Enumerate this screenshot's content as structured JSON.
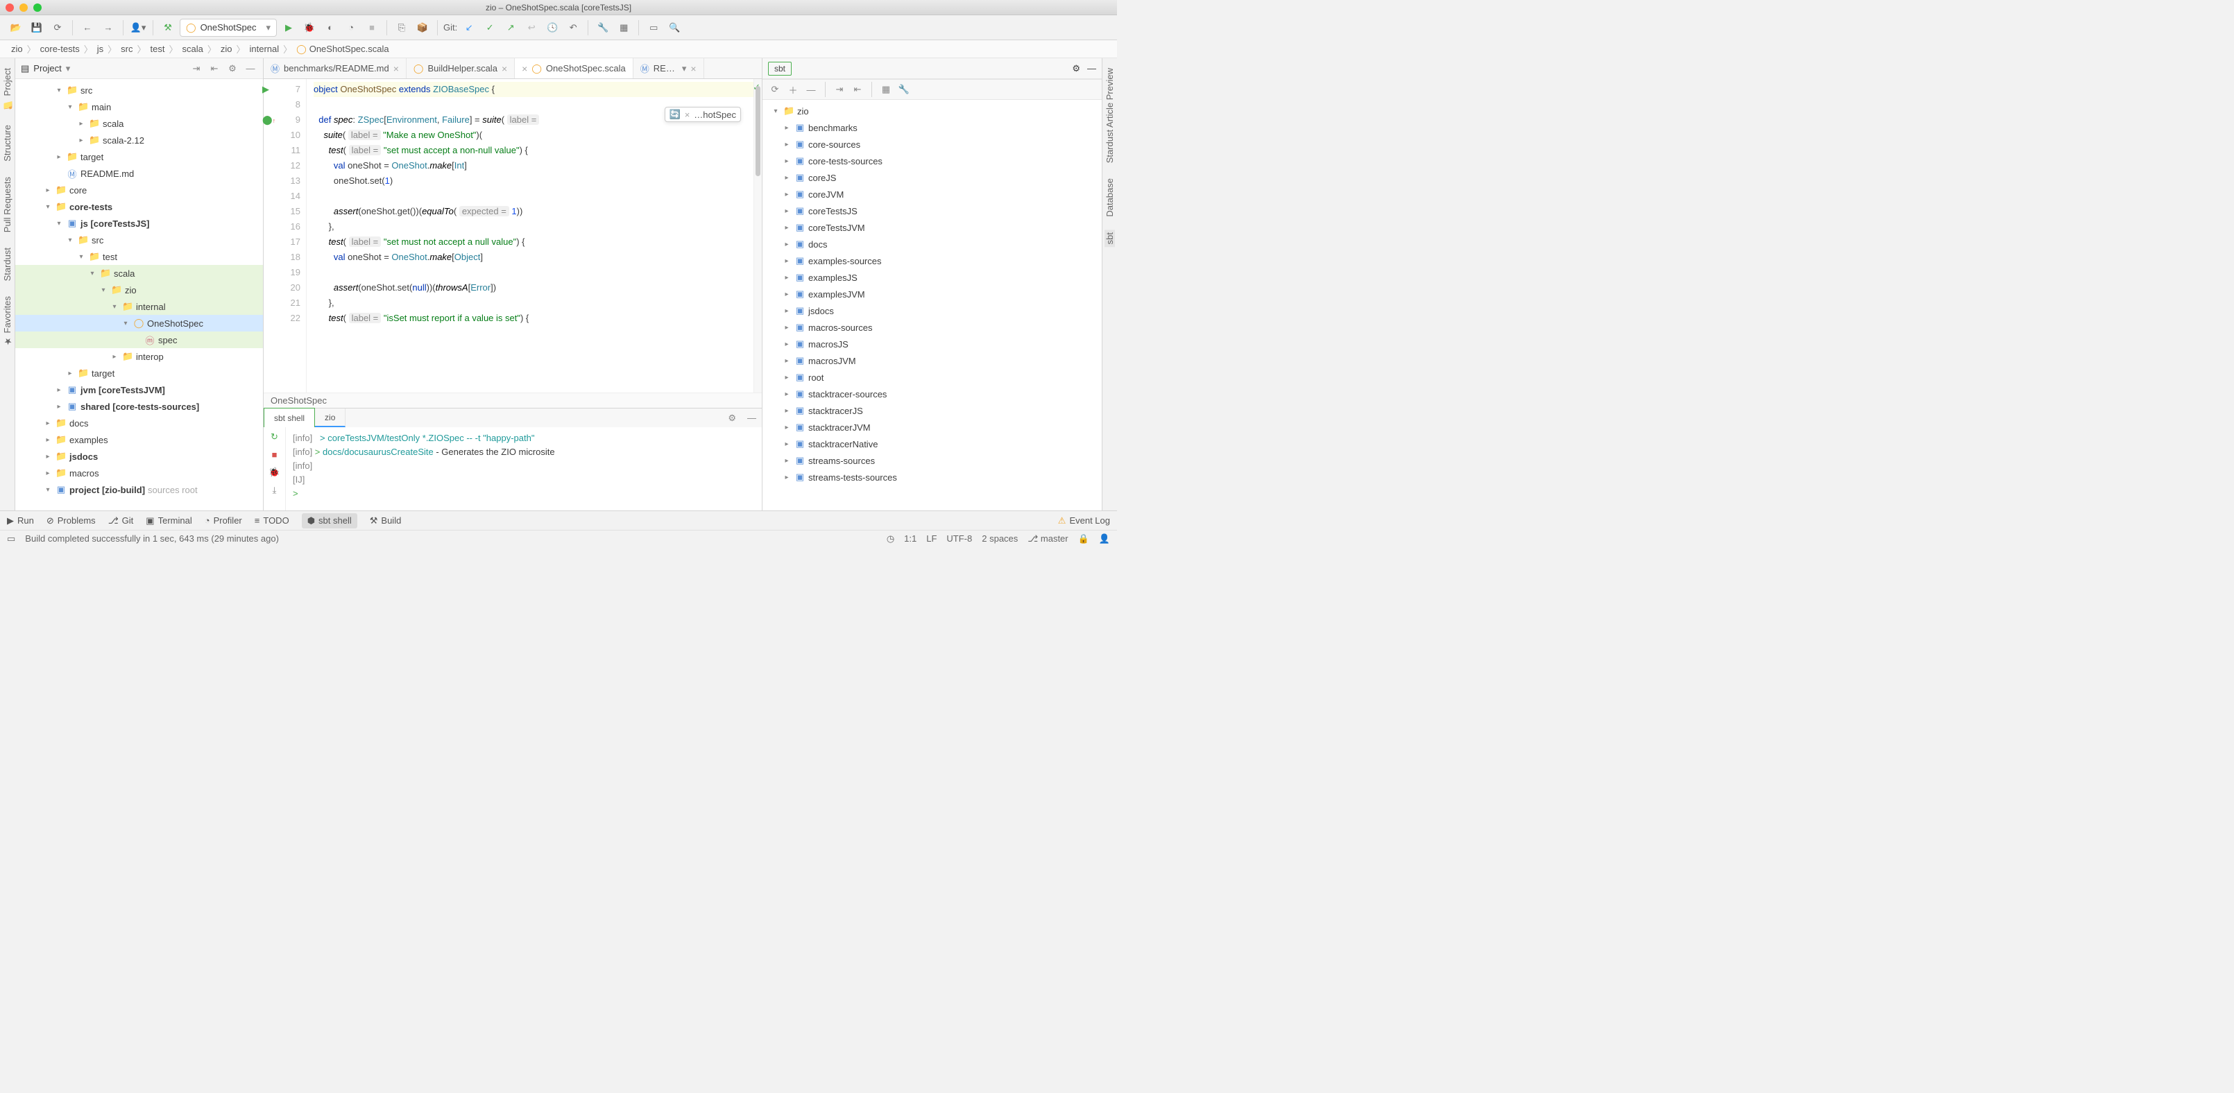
{
  "title": "zio – OneShotSpec.scala [coreTestsJS]",
  "runConfig": "OneShotSpec",
  "gitLabel": "Git:",
  "breadcrumb": [
    "zio",
    "core-tests",
    "js",
    "src",
    "test",
    "scala",
    "zio",
    "internal",
    "OneShotSpec.scala"
  ],
  "projectPanel": {
    "title": "Project"
  },
  "tree": [
    {
      "d": 3,
      "a": "▾",
      "i": "folder",
      "t": "src"
    },
    {
      "d": 4,
      "a": "▾",
      "i": "folder",
      "t": "main"
    },
    {
      "d": 5,
      "a": "▸",
      "i": "pkg",
      "t": "scala"
    },
    {
      "d": 5,
      "a": "▸",
      "i": "pkg",
      "t": "scala-2.12"
    },
    {
      "d": 3,
      "a": "▸",
      "i": "folder",
      "t": "target"
    },
    {
      "d": 3,
      "a": "",
      "i": "md",
      "t": "README.md"
    },
    {
      "d": 2,
      "a": "▸",
      "i": "folder",
      "t": "core"
    },
    {
      "d": 2,
      "a": "▾",
      "i": "folder",
      "t": "core-tests",
      "bold": true
    },
    {
      "d": 3,
      "a": "▾",
      "i": "mod",
      "t": "js [coreTestsJS]",
      "bold": true
    },
    {
      "d": 4,
      "a": "▾",
      "i": "folder",
      "t": "src"
    },
    {
      "d": 5,
      "a": "▾",
      "i": "folder",
      "t": "test"
    },
    {
      "d": 6,
      "a": "▾",
      "i": "pkg",
      "t": "scala",
      "hl": true
    },
    {
      "d": 7,
      "a": "▾",
      "i": "pkg",
      "t": "zio",
      "hl": true
    },
    {
      "d": 8,
      "a": "▾",
      "i": "pkg",
      "t": "internal",
      "hl": true
    },
    {
      "d": 9,
      "a": "▾",
      "i": "cls",
      "t": "OneShotSpec",
      "sel": true
    },
    {
      "d": 10,
      "a": "",
      "i": "meth",
      "t": "spec",
      "hl": true
    },
    {
      "d": 8,
      "a": "▸",
      "i": "pkg",
      "t": "interop"
    },
    {
      "d": 4,
      "a": "▸",
      "i": "folder",
      "t": "target"
    },
    {
      "d": 3,
      "a": "▸",
      "i": "mod",
      "t": "jvm [coreTestsJVM]",
      "bold": true
    },
    {
      "d": 3,
      "a": "▸",
      "i": "mod",
      "t": "shared [core-tests-sources]",
      "bold": true
    },
    {
      "d": 2,
      "a": "▸",
      "i": "folder",
      "t": "docs"
    },
    {
      "d": 2,
      "a": "▸",
      "i": "folder",
      "t": "examples"
    },
    {
      "d": 2,
      "a": "▸",
      "i": "folder",
      "t": "jsdocs",
      "bold": true
    },
    {
      "d": 2,
      "a": "▸",
      "i": "folder",
      "t": "macros"
    },
    {
      "d": 2,
      "a": "▾",
      "i": "mod",
      "t": "project [zio-build]",
      "bold": true,
      "trail": "sources root"
    }
  ],
  "tabs": [
    {
      "icon": "md",
      "label": "benchmarks/README.md"
    },
    {
      "icon": "cls",
      "label": "BuildHelper.scala"
    },
    {
      "icon": "cls",
      "label": "OneShotSpec.scala",
      "active": true
    },
    {
      "icon": "md",
      "label": "RE…",
      "more": true
    }
  ],
  "lineNumbers": [
    7,
    8,
    9,
    10,
    11,
    12,
    13,
    14,
    15,
    16,
    17,
    18,
    19,
    20,
    21,
    22
  ],
  "hoverHint": "…hotSpec",
  "editorBreadcrumb": "OneShotSpec",
  "sbtPanel": {
    "title": "sbt"
  },
  "bottomTabs": [
    {
      "t": "sbt shell",
      "active": true
    },
    {
      "t": "zio",
      "u": true
    }
  ],
  "console": [
    {
      "p": "[info]",
      "c": "   > coreTestsJVM/testOnly *.ZIOSpec -- -t \"happy-path\"",
      "cmd": true
    },
    {
      "p": "[info]",
      "c": " > docs/docusaurusCreateSite - Generates the ZIO microsite",
      "cmd2": true
    },
    {
      "p": "[info]",
      "c": ""
    },
    {
      "p": "[IJ]",
      "c": ""
    },
    {
      "p": "",
      "c": ">",
      "prompt": true
    }
  ],
  "rightTree": [
    {
      "d": 0,
      "a": "▾",
      "i": "folder",
      "t": "zio"
    },
    {
      "d": 1,
      "a": "▸",
      "i": "mod",
      "t": "benchmarks"
    },
    {
      "d": 1,
      "a": "▸",
      "i": "mod",
      "t": "core-sources"
    },
    {
      "d": 1,
      "a": "▸",
      "i": "mod",
      "t": "core-tests-sources"
    },
    {
      "d": 1,
      "a": "▸",
      "i": "mod",
      "t": "coreJS"
    },
    {
      "d": 1,
      "a": "▸",
      "i": "mod",
      "t": "coreJVM"
    },
    {
      "d": 1,
      "a": "▸",
      "i": "mod",
      "t": "coreTestsJS"
    },
    {
      "d": 1,
      "a": "▸",
      "i": "mod",
      "t": "coreTestsJVM"
    },
    {
      "d": 1,
      "a": "▸",
      "i": "mod",
      "t": "docs"
    },
    {
      "d": 1,
      "a": "▸",
      "i": "mod",
      "t": "examples-sources"
    },
    {
      "d": 1,
      "a": "▸",
      "i": "mod",
      "t": "examplesJS"
    },
    {
      "d": 1,
      "a": "▸",
      "i": "mod",
      "t": "examplesJVM"
    },
    {
      "d": 1,
      "a": "▸",
      "i": "mod",
      "t": "jsdocs"
    },
    {
      "d": 1,
      "a": "▸",
      "i": "mod",
      "t": "macros-sources"
    },
    {
      "d": 1,
      "a": "▸",
      "i": "mod",
      "t": "macrosJS"
    },
    {
      "d": 1,
      "a": "▸",
      "i": "mod",
      "t": "macrosJVM"
    },
    {
      "d": 1,
      "a": "▸",
      "i": "mod",
      "t": "root"
    },
    {
      "d": 1,
      "a": "▸",
      "i": "mod",
      "t": "stacktracer-sources"
    },
    {
      "d": 1,
      "a": "▸",
      "i": "mod",
      "t": "stacktracerJS"
    },
    {
      "d": 1,
      "a": "▸",
      "i": "mod",
      "t": "stacktracerJVM"
    },
    {
      "d": 1,
      "a": "▸",
      "i": "mod",
      "t": "stacktracerNative"
    },
    {
      "d": 1,
      "a": "▸",
      "i": "mod",
      "t": "streams-sources"
    },
    {
      "d": 1,
      "a": "▸",
      "i": "mod",
      "t": "streams-tests-sources"
    }
  ],
  "leftGutter": [
    "Project",
    "Structure",
    "Pull Requests",
    "Stardust",
    "Favorites"
  ],
  "rightGutter": [
    "Stardust Article Preview",
    "Database",
    "sbt"
  ],
  "footbar": [
    "Run",
    "Problems",
    "Git",
    "Terminal",
    "Profiler",
    "TODO",
    "sbt shell",
    "Build"
  ],
  "eventLog": "Event Log",
  "status": {
    "msg": "Build completed successfully in 1 sec, 643 ms (29 minutes ago)",
    "pos": "1:1",
    "lf": "LF",
    "enc": "UTF-8",
    "indent": "2 spaces",
    "branch": "master"
  }
}
